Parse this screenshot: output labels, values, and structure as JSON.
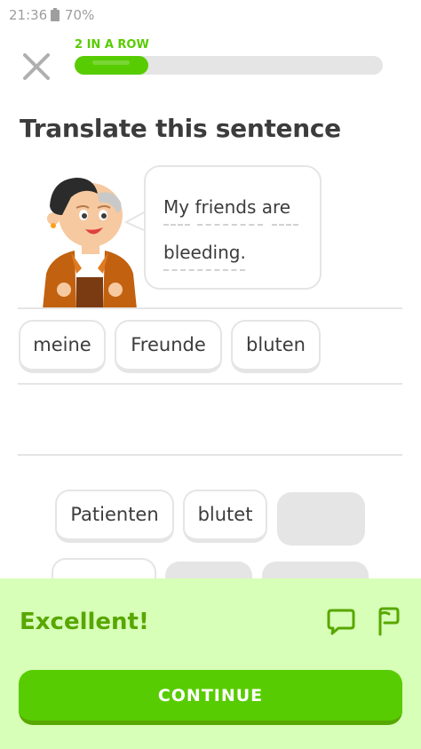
{
  "status_bar": {
    "time": "21:36",
    "battery": "70%"
  },
  "header": {
    "streak_label": "2 IN A ROW",
    "progress": 0.24
  },
  "prompt": {
    "heading": "Translate this sentence",
    "bubble_line_1": "My friends are",
    "bubble_line_2": "bleeding."
  },
  "answer_tiles": [
    "meine",
    "Freunde",
    "bluten"
  ],
  "word_bank": [
    "Patienten",
    "blutet"
  ],
  "feedback": {
    "title": "Excellent!",
    "continue_label": "CONTINUE"
  },
  "colors": {
    "accent": "#58cc02",
    "feedback_background": "#d7ffb8",
    "feedback_text": "#58a700"
  }
}
